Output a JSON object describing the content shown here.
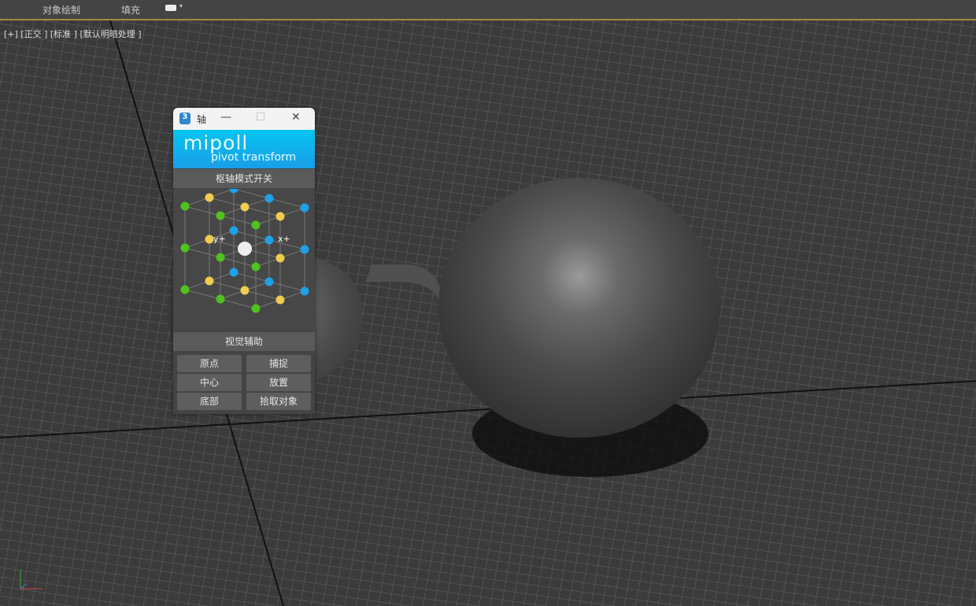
{
  "menu": {
    "item1": "对象绘制",
    "item2": "填充"
  },
  "viewport": {
    "label": "[+] [正交 ] [标准 ] [默认明暗处理 ]"
  },
  "dialog": {
    "app_icon": "3",
    "title": "轴",
    "logo_line1": "mipoll",
    "logo_line2": "pivot transform",
    "pivot_toggle": "枢轴模式开关",
    "y_label": "y+",
    "x_label": "x+",
    "visual_aid": "视觉辅助",
    "buttons": [
      "原点",
      "捕捉",
      "中心",
      "放置",
      "底部",
      "拾取对象"
    ]
  },
  "colors": {
    "green": "#4fc21e",
    "yellow": "#f0cc50",
    "blue": "#1fa0e8",
    "accent": "#06c5f0"
  }
}
